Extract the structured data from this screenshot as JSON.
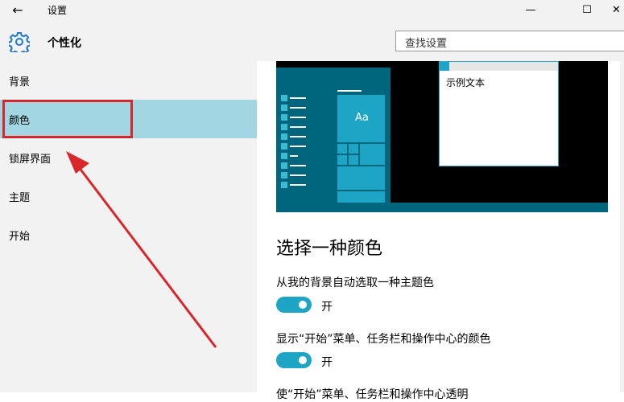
{
  "window": {
    "title": "设置",
    "back_icon": "←",
    "min_icon": "—",
    "max_icon": "☐",
    "close_icon": "✕"
  },
  "header": {
    "title": "个性化",
    "gear_icon": "gear-icon",
    "search_placeholder": "查找设置"
  },
  "sidebar": {
    "items": [
      {
        "label": "背景",
        "selected": false
      },
      {
        "label": "颜色",
        "selected": true
      },
      {
        "label": "锁屏界面",
        "selected": false
      },
      {
        "label": "主题",
        "selected": false
      },
      {
        "label": "开始",
        "selected": false
      }
    ]
  },
  "preview": {
    "tile_text": "Aa",
    "sample_text": "示例文本"
  },
  "main": {
    "heading": "选择一种颜色",
    "settings": [
      {
        "label": "从我的背景自动选取一种主题色",
        "state": "开"
      },
      {
        "label": "显示“开始”菜单、任务栏和操作中心的颜色",
        "state": "开"
      },
      {
        "label": "使“开始”菜单、任务栏和操作中心透明"
      }
    ]
  },
  "colors": {
    "accent": "#1ea5c6",
    "selection": "#a2d6e2",
    "annotation": "#d9262a",
    "preview_panel": "#00667e"
  }
}
